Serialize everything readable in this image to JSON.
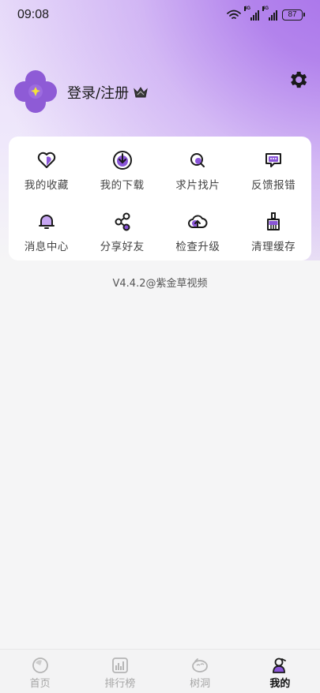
{
  "status_bar": {
    "time": "09:08",
    "signal_tag_1": "4G",
    "signal_tag_2": "4G",
    "battery": "87"
  },
  "profile": {
    "login_label": "登录/注册",
    "avatar_icon": "violet-flower-icon",
    "crown_icon": "crown-icon",
    "settings_icon": "gear-icon"
  },
  "menu": {
    "items": [
      {
        "label": "我的收藏",
        "icon": "heart-icon"
      },
      {
        "label": "我的下载",
        "icon": "download-icon"
      },
      {
        "label": "求片找片",
        "icon": "search-icon"
      },
      {
        "label": "反馈报错",
        "icon": "feedback-icon"
      },
      {
        "label": "消息中心",
        "icon": "bell-icon"
      },
      {
        "label": "分享好友",
        "icon": "share-icon"
      },
      {
        "label": "检查升级",
        "icon": "cloud-upload-icon"
      },
      {
        "label": "清理缓存",
        "icon": "broom-icon"
      }
    ]
  },
  "version": "V4.4.2@紫金草视频",
  "bottom_nav": {
    "items": [
      {
        "label": "首页",
        "icon": "home-icon",
        "active": false
      },
      {
        "label": "排行榜",
        "icon": "ranking-icon",
        "active": false
      },
      {
        "label": "树洞",
        "icon": "tree-hole-icon",
        "active": false
      },
      {
        "label": "我的",
        "icon": "profile-icon",
        "active": true
      }
    ]
  },
  "colors": {
    "accent": "#8a55d8",
    "accent_light": "#c7a6f2",
    "text_primary": "#1a1a1a",
    "nav_inactive": "#a6a6a6"
  }
}
